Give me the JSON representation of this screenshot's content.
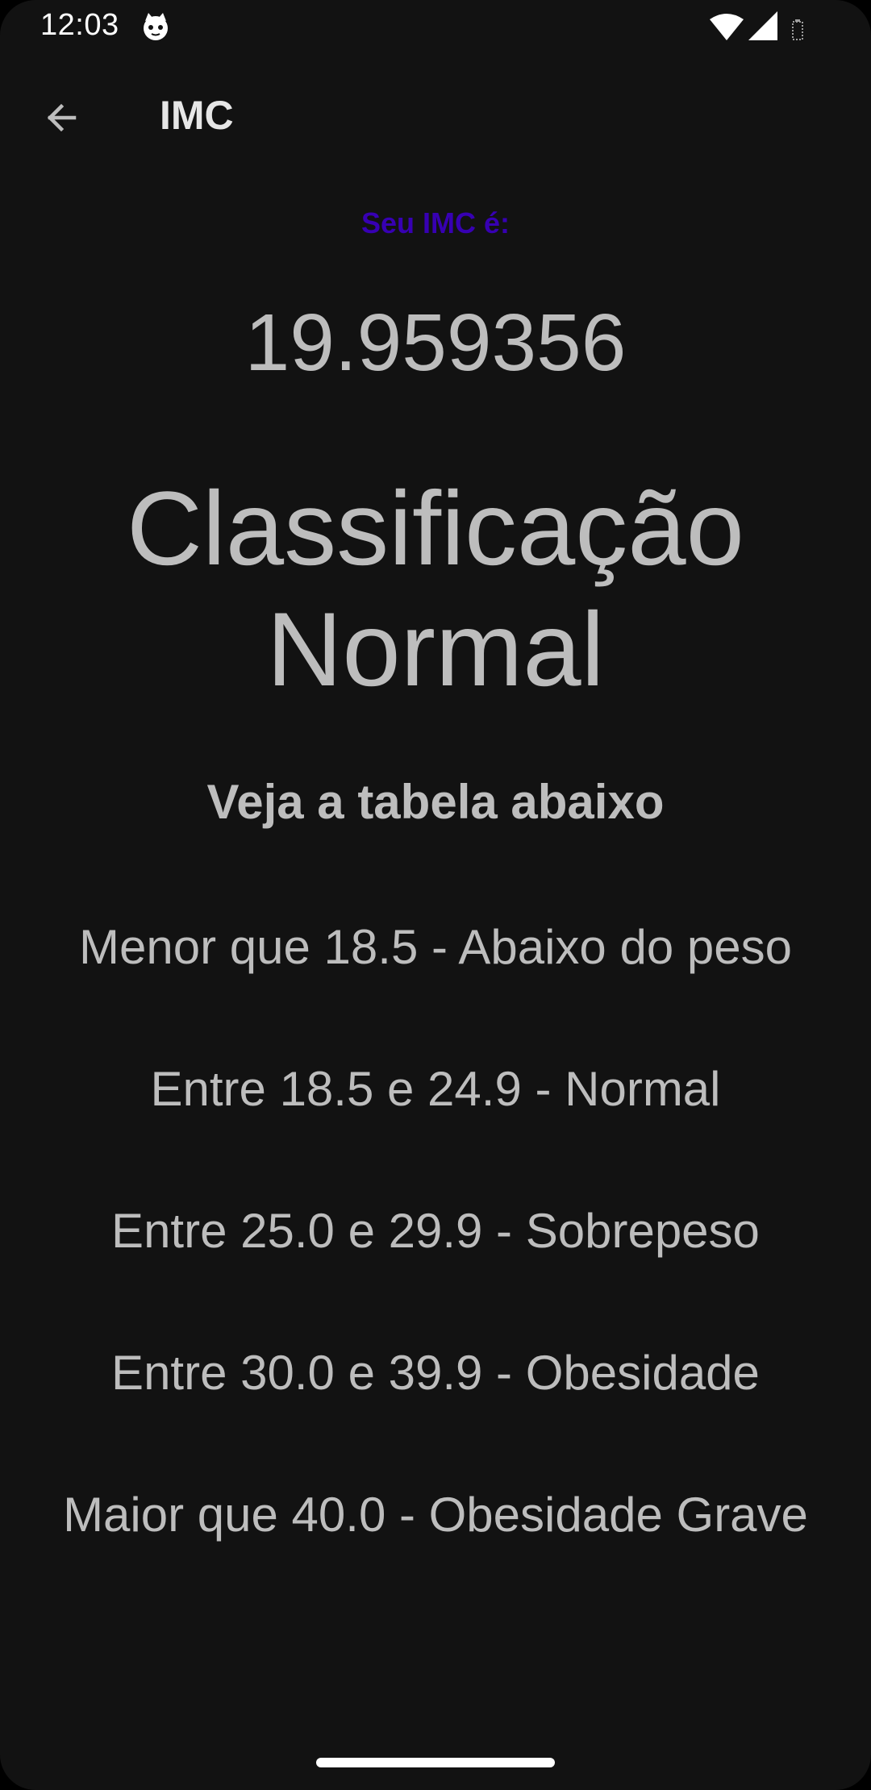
{
  "status_bar": {
    "time": "12:03",
    "icons": [
      "cat-icon",
      "wifi-icon",
      "signal-icon",
      "battery-icon"
    ]
  },
  "app_bar": {
    "title": "IMC",
    "back_icon": "arrow-left-icon"
  },
  "result": {
    "label": "Seu IMC é:",
    "value": "19.959356",
    "classification_line1": "Classificação",
    "classification_line2": "Normal"
  },
  "table": {
    "heading": "Veja a tabela abaixo",
    "rows": [
      "Menor que 18.5 - Abaixo do peso",
      "Entre 18.5 e 24.9 - Normal",
      "Entre 25.0 e 29.9 - Sobrepeso",
      "Entre 30.0 e 39.9 - Obesidade",
      "Maior que 40.0 - Obesidade Grave"
    ]
  },
  "colors": {
    "background": "#121212",
    "text": "#bdbdbd",
    "accent": "#3700b3"
  }
}
